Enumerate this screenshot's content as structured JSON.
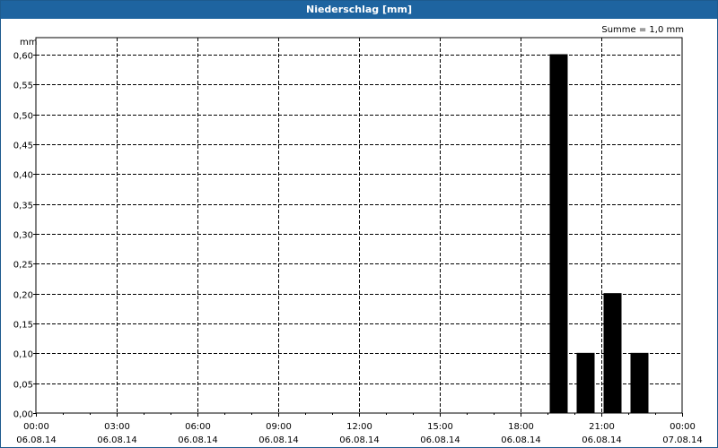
{
  "window": {
    "title": "Niederschlag [mm]"
  },
  "chart_data": {
    "type": "bar",
    "title": "Niederschlag [mm]",
    "ylabel": "mm",
    "annotation": "Summe = 1,0 mm",
    "ylim": [
      0,
      0.6
    ],
    "y_ticks": [
      "0,00",
      "0,05",
      "0,10",
      "0,15",
      "0,20",
      "0,25",
      "0,30",
      "0,35",
      "0,40",
      "0,45",
      "0,50",
      "0,55",
      "0,60"
    ],
    "xlim_hours": [
      0,
      24
    ],
    "x_ticks": [
      {
        "time": "00:00",
        "date": "06.08.14"
      },
      {
        "time": "03:00",
        "date": "06.08.14"
      },
      {
        "time": "06:00",
        "date": "06.08.14"
      },
      {
        "time": "09:00",
        "date": "06.08.14"
      },
      {
        "time": "12:00",
        "date": "06.08.14"
      },
      {
        "time": "15:00",
        "date": "06.08.14"
      },
      {
        "time": "18:00",
        "date": "06.08.14"
      },
      {
        "time": "21:00",
        "date": "06.08.14"
      },
      {
        "time": "00:00",
        "date": "07.08.14"
      }
    ],
    "bars": [
      {
        "start_hour": 19,
        "end_hour": 20,
        "value": 0.6
      },
      {
        "start_hour": 20,
        "end_hour": 21,
        "value": 0.1
      },
      {
        "start_hour": 21,
        "end_hour": 22,
        "value": 0.2
      },
      {
        "start_hour": 22,
        "end_hour": 23,
        "value": 0.1
      }
    ],
    "grid": true,
    "bar_color": "#000000"
  }
}
